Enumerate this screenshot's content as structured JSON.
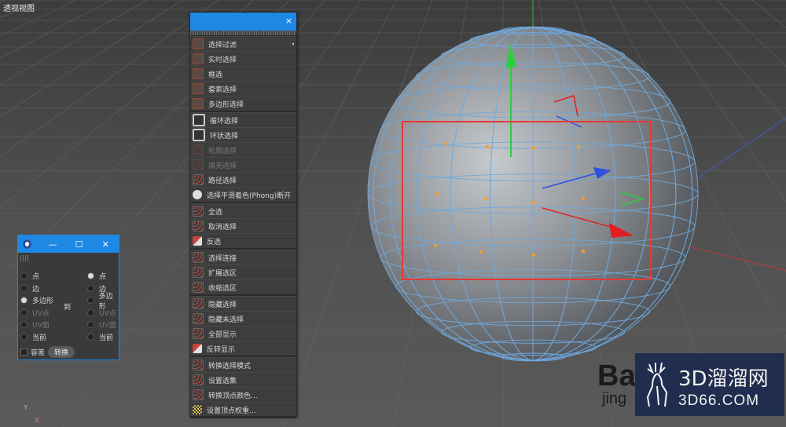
{
  "viewport": {
    "title": "透视视图",
    "axis_y": "Y",
    "axis_x": "X"
  },
  "menu": {
    "close": "×",
    "groups": [
      [
        {
          "label": "选择过滤",
          "icon": "selection-filter-icon",
          "has_arrow": true
        },
        {
          "label": "实时选择",
          "icon": "live-selection-icon"
        },
        {
          "label": "框选",
          "icon": "rectangle-selection-icon"
        },
        {
          "label": "套索选择",
          "icon": "lasso-selection-icon"
        },
        {
          "label": "多边形选择",
          "icon": "polygon-selection-icon"
        }
      ],
      [
        {
          "label": "循环选择",
          "icon": "loop-selection-icon"
        },
        {
          "label": "环状选择",
          "icon": "ring-selection-icon"
        },
        {
          "label": "轮廓选择",
          "icon": "outline-selection-icon",
          "disabled": true
        },
        {
          "label": "填充选择",
          "icon": "fill-selection-icon",
          "disabled": true
        },
        {
          "label": "路径选择",
          "icon": "path-selection-icon"
        },
        {
          "label": "选择平滑着色(Phong)断开",
          "icon": "phong-break-icon"
        }
      ],
      [
        {
          "label": "全选",
          "icon": "select-all-icon"
        },
        {
          "label": "取消选择",
          "icon": "deselect-all-icon"
        },
        {
          "label": "反选",
          "icon": "invert-selection-icon"
        }
      ],
      [
        {
          "label": "选择连接",
          "icon": "select-connected-icon"
        },
        {
          "label": "扩展选区",
          "icon": "grow-selection-icon"
        },
        {
          "label": "收缩选区",
          "icon": "shrink-selection-icon"
        }
      ],
      [
        {
          "label": "隐藏选择",
          "icon": "hide-selected-icon"
        },
        {
          "label": "隐藏未选择",
          "icon": "hide-unselected-icon"
        },
        {
          "label": "全部显示",
          "icon": "unhide-all-icon"
        },
        {
          "label": "反转显示",
          "icon": "invert-visibility-icon"
        }
      ],
      [
        {
          "label": "转换选择模式",
          "icon": "convert-selection-icon"
        },
        {
          "label": "设置选集",
          "icon": "set-selection-icon"
        },
        {
          "label": "转换顶点颜色...",
          "icon": "convert-vertex-color-icon"
        },
        {
          "label": "设置顶点权重...",
          "icon": "set-vertex-weight-icon"
        }
      ]
    ]
  },
  "convert_window": {
    "minimize": "—",
    "maximize": "☐",
    "close": "✕",
    "left_options": [
      "点",
      "边",
      "多边形",
      "UV点",
      "UV面",
      "当前"
    ],
    "right_options": [
      "点",
      "边",
      "多边形",
      "UV点",
      "UV面",
      "当前"
    ],
    "left_selected": 2,
    "right_selected": 0,
    "to_label": "到",
    "tolerance_label": "容差",
    "convert_button": "转换"
  },
  "watermark": {
    "brand": "3D溜溜网",
    "url": "3D66.COM",
    "baidu": "Ba",
    "baidu_sub": "jing"
  },
  "colors": {
    "accent": "#1e88e5",
    "selection_box": "#e53935",
    "mesh_wire": "#6fa8dc",
    "points": "#f0a030"
  }
}
